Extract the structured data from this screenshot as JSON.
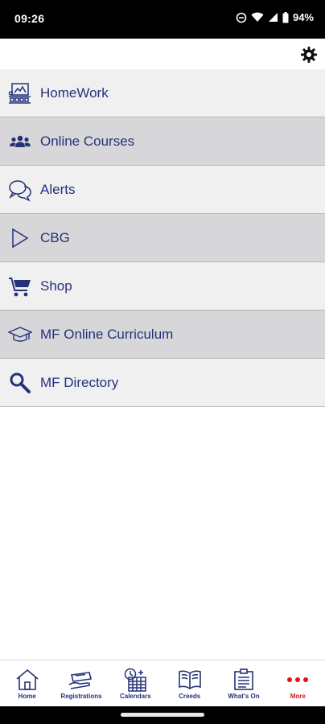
{
  "status": {
    "time": "09:26",
    "battery": "94%"
  },
  "settings": {
    "icon": "gear-icon"
  },
  "menu": {
    "items": [
      {
        "label": "HomeWork",
        "icon": "homework-icon"
      },
      {
        "label": "Online Courses",
        "icon": "people-icon"
      },
      {
        "label": "Alerts",
        "icon": "chat-bubbles-icon"
      },
      {
        "label": "CBG",
        "icon": "play-icon"
      },
      {
        "label": "Shop",
        "icon": "cart-icon"
      },
      {
        "label": "MF Online Curriculum",
        "icon": "graduation-cap-icon"
      },
      {
        "label": "MF Directory",
        "icon": "search-icon"
      }
    ]
  },
  "bottom_nav": {
    "items": [
      {
        "label": "Home",
        "icon": "home-icon"
      },
      {
        "label": "Registrations",
        "icon": "registration-icon"
      },
      {
        "label": "Calendars",
        "icon": "calendar-icon"
      },
      {
        "label": "Creeds",
        "icon": "book-icon"
      },
      {
        "label": "What's On",
        "icon": "noticeboard-icon"
      },
      {
        "label": "More",
        "icon": "more-dots-icon"
      }
    ]
  },
  "colors": {
    "accent": "#24327a",
    "active": "#e0101a",
    "row_light": "#f0f0f1",
    "row_dark": "#d7d7d9"
  }
}
